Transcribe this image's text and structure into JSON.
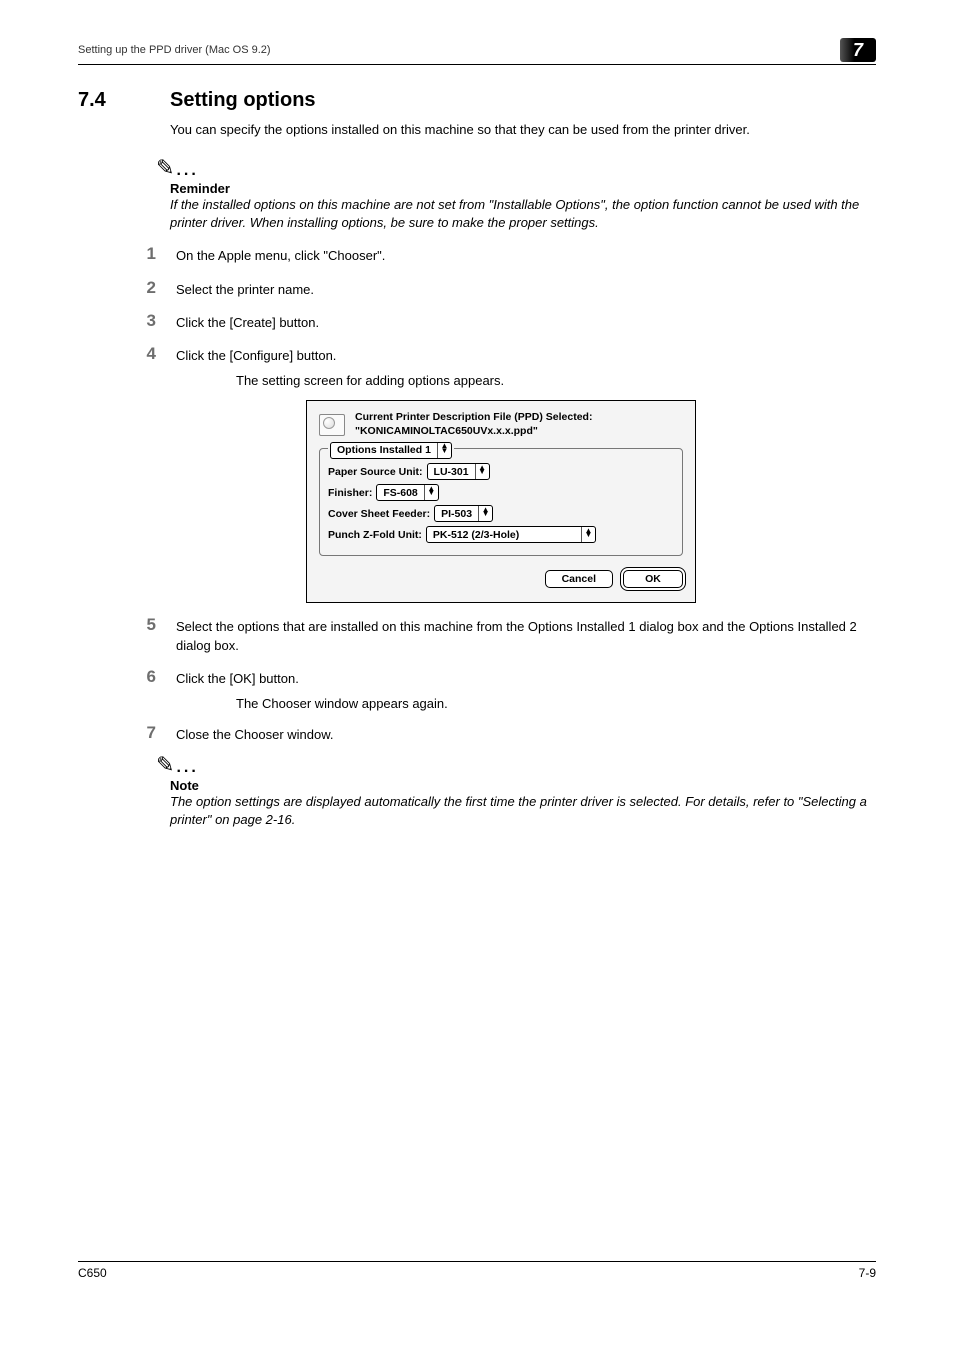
{
  "header": {
    "breadcrumb": "Setting up the PPD driver (Mac OS 9.2)",
    "chapter": "7"
  },
  "section": {
    "number": "7.4",
    "title": "Setting options",
    "intro": "You can specify the options installed on this machine so that they can be used from the printer driver."
  },
  "reminder": {
    "heading": "Reminder",
    "body": "If the installed options on this machine are not set from \"Installable Options\", the option function cannot be used with the printer driver. When installing options, be sure to make the proper settings."
  },
  "steps": [
    {
      "n": "1",
      "text": "On the Apple menu, click \"Chooser\"."
    },
    {
      "n": "2",
      "text": "Select the printer name."
    },
    {
      "n": "3",
      "text": "Click the [Create] button."
    },
    {
      "n": "4",
      "text": "Click the [Configure] button.",
      "sub": "The setting screen for adding options appears."
    },
    {
      "n": "5",
      "text": "Select the options that are installed on this machine from the Options Installed 1 dialog box and the Options Installed 2 dialog box."
    },
    {
      "n": "6",
      "text": "Click the [OK] button.",
      "sub": "The Chooser window appears again."
    },
    {
      "n": "7",
      "text": "Close the Chooser window."
    }
  ],
  "dialog": {
    "title_line1": "Current Printer Description File (PPD) Selected:",
    "title_line2": "\"KONICAMINOLTAC650UVx.x.x.ppd\"",
    "group_selector": "Options Installed 1",
    "rows": {
      "paper_source": {
        "label": "Paper Source Unit:",
        "value": "LU-301"
      },
      "finisher": {
        "label": "Finisher:",
        "value": "FS-608"
      },
      "cover": {
        "label": "Cover Sheet Feeder:",
        "value": "PI-503"
      },
      "punch": {
        "label": "Punch Z-Fold Unit:",
        "value": "PK-512 (2/3-Hole)"
      }
    },
    "buttons": {
      "cancel": "Cancel",
      "ok": "OK"
    }
  },
  "note": {
    "heading": "Note",
    "body": "The option settings are displayed automatically the first time the printer driver is selected. For details, refer to \"Selecting a printer\" on page 2-16."
  },
  "footer": {
    "left": "C650",
    "right": "7-9"
  }
}
